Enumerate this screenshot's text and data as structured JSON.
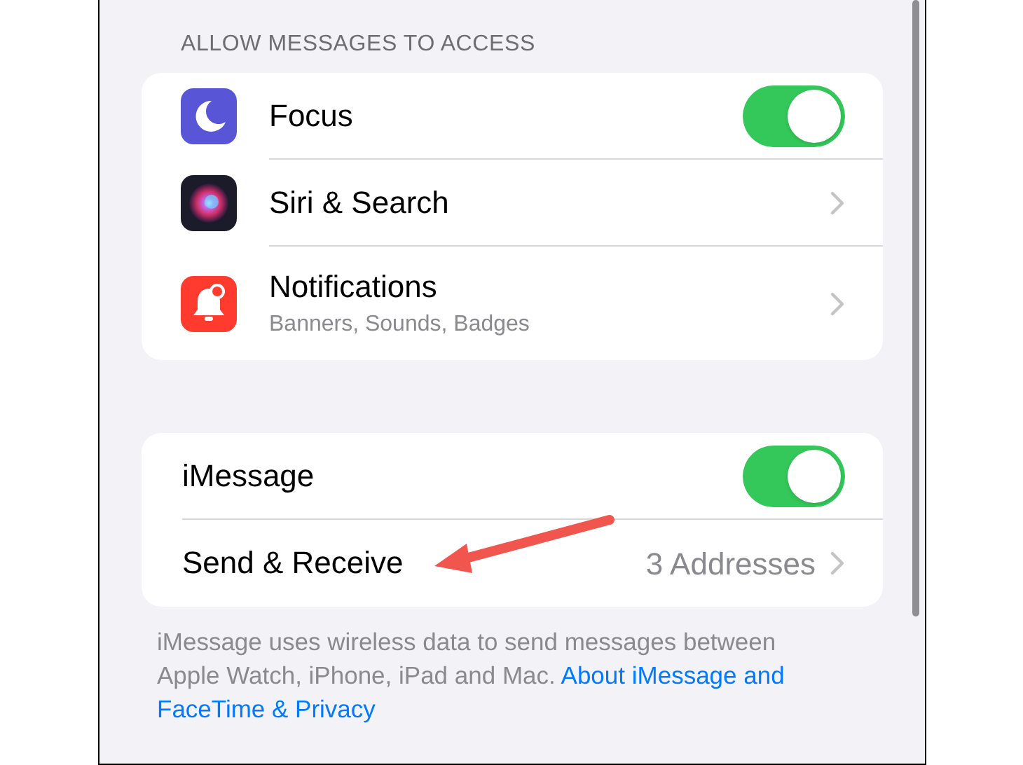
{
  "section_header": "ALLOW MESSAGES TO ACCESS",
  "access_items": [
    {
      "kind": "toggle",
      "label": "Focus",
      "on": true
    },
    {
      "kind": "link",
      "label": "Siri & Search"
    },
    {
      "kind": "link",
      "label": "Notifications",
      "subtitle": "Banners, Sounds, Badges"
    }
  ],
  "imessage_items": [
    {
      "kind": "toggle",
      "label": "iMessage",
      "on": true
    },
    {
      "kind": "link",
      "label": "Send & Receive",
      "value": "3 Addresses"
    }
  ],
  "footer": {
    "text": "iMessage uses wireless data to send messages between Apple Watch, iPhone, iPad and Mac.",
    "link_lines": [
      "About iMessage and",
      "FaceTime & Privacy"
    ]
  }
}
